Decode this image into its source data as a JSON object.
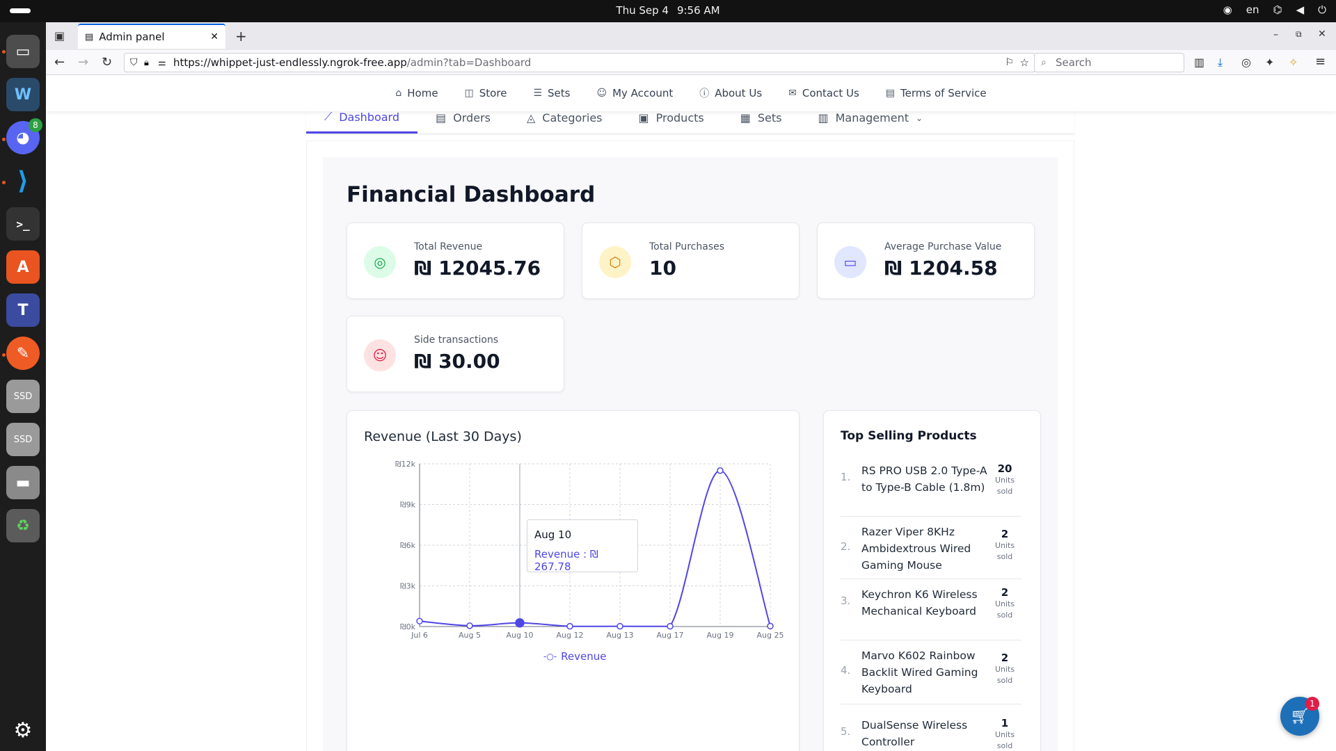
{
  "system": {
    "date": "Thu Sep 4",
    "time": "9:56 AM",
    "lang": "en"
  },
  "dock": {
    "discord_badge": "8",
    "ssd_label": "SSD"
  },
  "browser": {
    "tab_title": "Admin panel",
    "url_host": "https://whippet-just-endlessly.ngrok-free.app",
    "url_path": "/admin?tab=Dashboard",
    "search_placeholder": "Search"
  },
  "sitenav": {
    "items": [
      {
        "label": "Home",
        "icon": "home-icon"
      },
      {
        "label": "Store",
        "icon": "bag-icon"
      },
      {
        "label": "Sets",
        "icon": "list-icon"
      },
      {
        "label": "My Account",
        "icon": "user-icon"
      },
      {
        "label": "About Us",
        "icon": "info-icon"
      },
      {
        "label": "Contact Us",
        "icon": "mail-icon"
      },
      {
        "label": "Terms of Service",
        "icon": "document-icon"
      }
    ]
  },
  "admin_tabs": {
    "items": [
      {
        "label": "Dashboard",
        "icon": "chart-icon"
      },
      {
        "label": "Orders",
        "icon": "receipt-icon"
      },
      {
        "label": "Categories",
        "icon": "shapes-icon"
      },
      {
        "label": "Products",
        "icon": "box-icon"
      },
      {
        "label": "Sets",
        "icon": "grid-icon"
      },
      {
        "label": "Management",
        "icon": "layout-icon"
      }
    ]
  },
  "dashboard": {
    "title": "Financial Dashboard",
    "cards": [
      {
        "label": "Total Revenue",
        "value": "₪ 12045.76",
        "icon": "coins-icon"
      },
      {
        "label": "Total Purchases",
        "value": "10",
        "icon": "package-icon"
      },
      {
        "label": "Average Purchase Value",
        "value": "₪ 1204.58",
        "icon": "wallet-icon"
      },
      {
        "label": "Side transactions",
        "value": "₪ 30.00",
        "icon": "smile-icon"
      }
    ]
  },
  "revenue_chart": {
    "title": "Revenue (Last 30 Days)",
    "tooltip_date": "Aug 10",
    "tooltip_value": "Revenue : ₪ 267.78",
    "legend": "Revenue"
  },
  "chart_data": {
    "type": "line",
    "title": "Revenue (Last 30 Days)",
    "x": [
      "Jul 6",
      "Aug 5",
      "Aug 10",
      "Aug 12",
      "Aug 13",
      "Aug 17",
      "Aug 19",
      "Aug 25"
    ],
    "series": [
      {
        "name": "Revenue",
        "values": [
          400,
          60,
          267.78,
          20,
          20,
          20,
          11500,
          30
        ]
      }
    ],
    "ytick_labels": [
      "₪0k",
      "₪3k",
      "₪6k",
      "₪9k",
      "₪12k"
    ],
    "ylim": [
      0,
      12000
    ],
    "grid": true,
    "legend": "bottom",
    "color": "#4f46e5"
  },
  "top_products": {
    "title": "Top Selling Products",
    "units_label": "Units sold",
    "items": [
      {
        "rank": "1.",
        "name": "RS PRO USB 2.0 Type-A to Type-B Cable (1.8m)",
        "units": "20"
      },
      {
        "rank": "2.",
        "name": "Razer Viper 8KHz Ambidextrous Wired Gaming Mouse",
        "units": "2"
      },
      {
        "rank": "3.",
        "name": "Keychron K6 Wireless Mechanical Keyboard",
        "units": "2"
      },
      {
        "rank": "4.",
        "name": "Marvo K602 Rainbow Backlit Wired Gaming Keyboard",
        "units": "2"
      },
      {
        "rank": "5.",
        "name": "DualSense Wireless Controller",
        "units": "1"
      }
    ]
  },
  "cart": {
    "count": "1"
  }
}
